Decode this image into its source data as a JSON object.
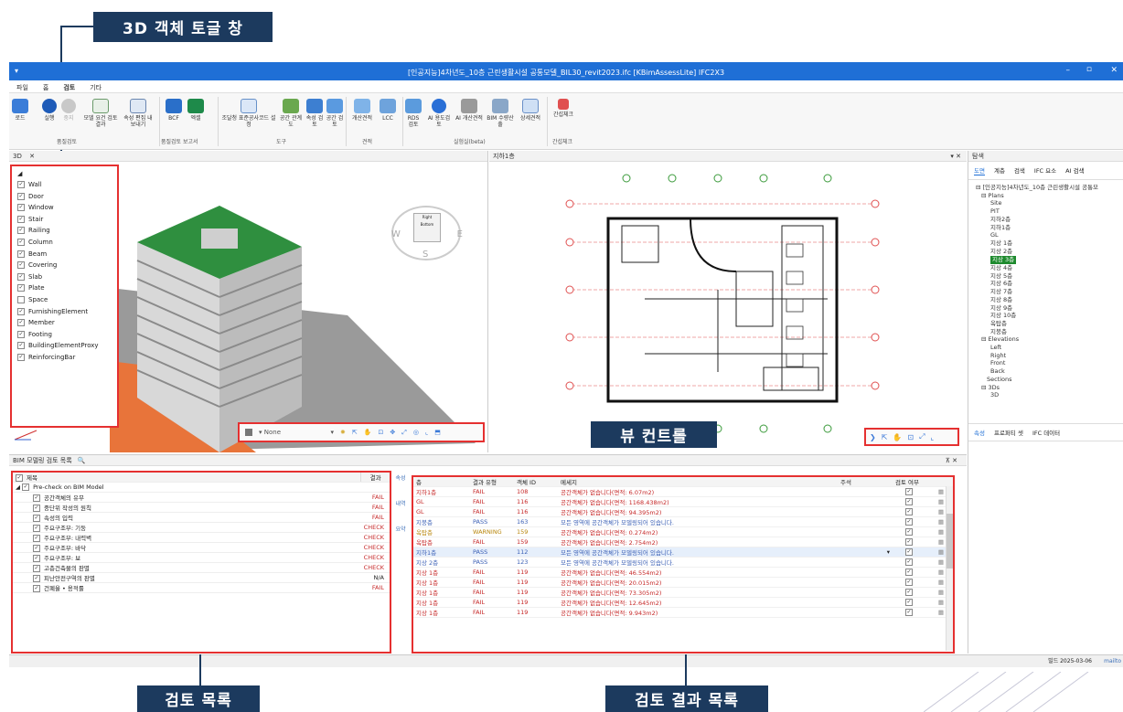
{
  "callouts": {
    "toggle": "3D 객체 토글 창",
    "view": "뷰 컨트롤",
    "list": "검토 목록",
    "results": "검토 결과 목록"
  },
  "window": {
    "title": "[인공지능]4차년도_10층 근린생활시설 공통모델_BIL30_revit2023.ifc [KBimAssessLite] IFC2X3",
    "min": "–",
    "restore": "▫",
    "close": "✕"
  },
  "menu": [
    "파일",
    "홈",
    "검토",
    "기타"
  ],
  "ribbon": {
    "buttons": [
      "로드",
      "실행",
      "중지",
      "모델 요건 검토 결과",
      "속성 편집 내보내기",
      "BCF",
      "엑셀",
      "조달청 표준공사코드 설정",
      "공간 관계도",
      "속성 검토",
      "공간 검토",
      "개산견적",
      "LCC",
      "RDS 검토",
      "AI 용도검토",
      "AI 개산견적",
      "BIM 수량산출",
      "상세견적",
      "간섭체크"
    ],
    "groups": [
      "품질검토",
      "품질검토 보고서",
      "도구",
      "견적",
      "실험실(beta)",
      "간섭체크"
    ]
  },
  "tabs": {
    "view3d": "3D",
    "close": "✕",
    "plan": "지하1층",
    "pin": "▾ ✕"
  },
  "object_toggle": [
    "Wall",
    "Door",
    "Window",
    "Stair",
    "Railing",
    "Column",
    "Beam",
    "Covering",
    "Slab",
    "Plate",
    "Space",
    "FurnishingElement",
    "Member",
    "Footing",
    "BuildingElementProxy",
    "ReinforcingBar"
  ],
  "object_checked": [
    true,
    true,
    true,
    true,
    true,
    true,
    true,
    true,
    true,
    true,
    false,
    true,
    true,
    true,
    true,
    true
  ],
  "view_control": {
    "style": "None"
  },
  "compass": {
    "w": "W",
    "e": "E",
    "s": "S",
    "top": "Right",
    "bottom": "Bottom"
  },
  "navigator": {
    "tabs": [
      "도면",
      "계층",
      "검색",
      "IFC 요소",
      "AI 검색"
    ],
    "panel_title": "탐색",
    "tree": [
      "⊟ [인공지능]4차년도_10층 근린생활시설 공통모",
      "⊟ Plans",
      "Site",
      "PIT",
      "지하2층",
      "지하1층",
      "GL",
      "지상 1층",
      "지상 2층",
      "지상 3층",
      "지상 4층",
      "지상 5층",
      "지상 6층",
      "지상 7층",
      "지상 8층",
      "지상 9층",
      "지상 10층",
      "옥탑층",
      "지붕층",
      "⊟ Elevations",
      "Left",
      "Right",
      "Front",
      "Back",
      "Sections",
      "⊟ 3Ds",
      "3D"
    ],
    "bottom_tabs": [
      "속성",
      "프로퍼티 셋",
      "IFC 데이터"
    ]
  },
  "check_list": {
    "panel_title": "BIM 모델링 검토 목록",
    "search_icon": "🔍",
    "col_title": "제목",
    "col_result": "결과",
    "root": "Pre-check on BIM Model",
    "items": [
      {
        "name": "공간객체의 유무",
        "result": "FAIL"
      },
      {
        "name": "중단위 작성의 원칙",
        "result": "FAIL"
      },
      {
        "name": "속성의 입력",
        "result": "FAIL"
      },
      {
        "name": "주요구조부: 기둥",
        "result": "CHECK"
      },
      {
        "name": "주요구조부: 내력벽",
        "result": "CHECK"
      },
      {
        "name": "주요구조부: 바닥",
        "result": "CHECK"
      },
      {
        "name": "주요구조부: 보",
        "result": "CHECK"
      },
      {
        "name": "고층건축물의 판별",
        "result": "CHECK"
      },
      {
        "name": "피난안전구역의 판별",
        "result": "N/A"
      },
      {
        "name": "건폐율 • 용적률",
        "result": "FAIL"
      }
    ]
  },
  "side_tabs": [
    "속성",
    "내역",
    "요약"
  ],
  "results": {
    "columns": [
      "층",
      "결과 유형",
      "객체 ID",
      "메세지",
      "주석",
      "검토 여부"
    ],
    "rows": [
      {
        "floor": "지하1층",
        "type": "FAIL",
        "id": "108",
        "msg": "공간객체가 없습니다(면적: 6.07m2)"
      },
      {
        "floor": "GL",
        "type": "FAIL",
        "id": "116",
        "msg": "공간객체가 없습니다(면적: 1168.438m2)"
      },
      {
        "floor": "GL",
        "type": "FAIL",
        "id": "116",
        "msg": "공간객체가 없습니다(면적: 94.395m2)"
      },
      {
        "floor": "지붕층",
        "type": "PASS",
        "id": "163",
        "msg": "모든 영역에 공간객체가 모델링되어 있습니다."
      },
      {
        "floor": "옥탑층",
        "type": "WARNING",
        "id": "159",
        "msg": "공간객체가 없습니다(면적: 0.274m2)"
      },
      {
        "floor": "옥탑층",
        "type": "FAIL",
        "id": "159",
        "msg": "공간객체가 없습니다(면적: 2.754m2)"
      },
      {
        "floor": "지하1층",
        "type": "PASS",
        "id": "112",
        "msg": "모든 영역에 공간객체가 모델링되어 있습니다."
      },
      {
        "floor": "지상 2층",
        "type": "PASS",
        "id": "123",
        "msg": "모든 영역에 공간객체가 모델링되어 있습니다."
      },
      {
        "floor": "지상 1층",
        "type": "FAIL",
        "id": "119",
        "msg": "공간객체가 없습니다(면적: 46.554m2)"
      },
      {
        "floor": "지상 1층",
        "type": "FAIL",
        "id": "119",
        "msg": "공간객체가 없습니다(면적: 20.015m2)"
      },
      {
        "floor": "지상 1층",
        "type": "FAIL",
        "id": "119",
        "msg": "공간객체가 없습니다(면적: 73.305m2)"
      },
      {
        "floor": "지상 1층",
        "type": "FAIL",
        "id": "119",
        "msg": "공간객체가 없습니다(면적: 12.645m2)"
      },
      {
        "floor": "지상 1층",
        "type": "FAIL",
        "id": "119",
        "msg": "공간객체가 없습니다(면적: 9.943m2)"
      }
    ]
  },
  "status": {
    "date": "빌드 2025-03-06",
    "link": "mailto"
  }
}
